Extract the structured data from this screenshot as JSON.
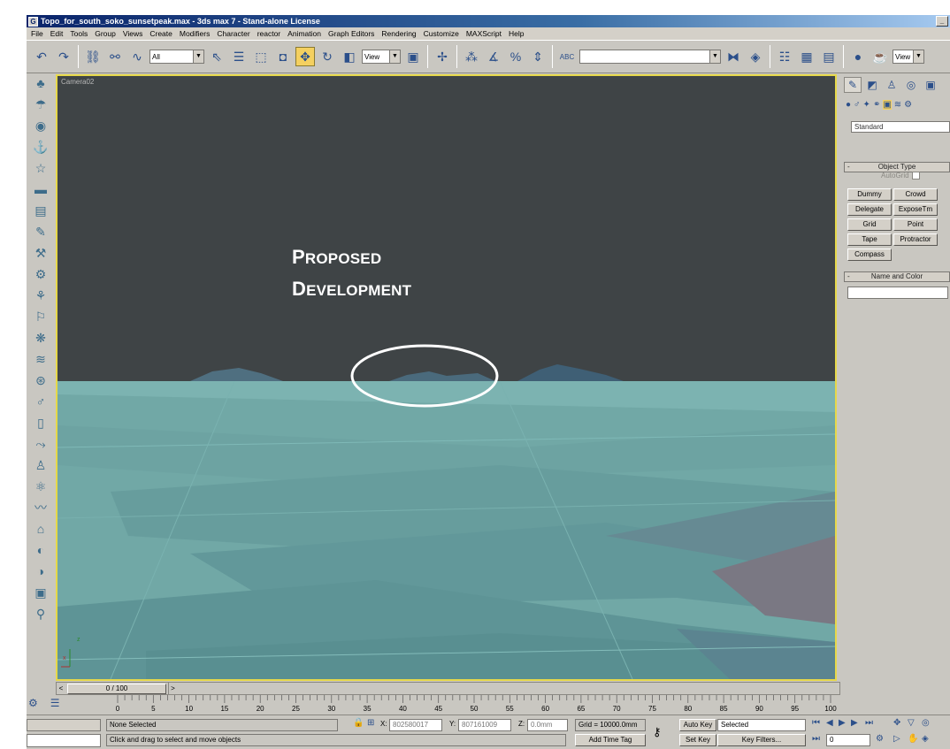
{
  "window": {
    "title": "Topo_for_south_soko_sunsetpeak.max - 3ds max 7 - Stand-alone License",
    "min_label": "_"
  },
  "menu": [
    "File",
    "Edit",
    "Tools",
    "Group",
    "Views",
    "Create",
    "Modifiers",
    "Character",
    "reactor",
    "Animation",
    "Graph Editors",
    "Rendering",
    "Customize",
    "MAXScript",
    "Help"
  ],
  "toolbar": {
    "selection_filter": "All",
    "reference_coord": "View",
    "named_selection": "",
    "viewport_select": "View",
    "snap_label": "ABC"
  },
  "viewport": {
    "label": "Camera02",
    "annotation_line1_cap": "P",
    "annotation_line1_rest": "ROPOSED",
    "annotation_line2_cap": "D",
    "annotation_line2_rest": "EVELOPMENT",
    "axis_z": "z",
    "axis_xy": "x"
  },
  "command_panel": {
    "category": "Standard",
    "object_type_title": "Object Type",
    "autogrid": "AutoGrid",
    "buttons": [
      "Dummy",
      "Crowd",
      "Delegate",
      "ExposeTm",
      "Grid",
      "Point",
      "Tape",
      "Protractor",
      "Compass"
    ],
    "name_color_title": "Name and Color"
  },
  "time_slider": {
    "frame": "0 / 100",
    "left": "<",
    "right": ">"
  },
  "track_labels": [
    "0",
    "5",
    "10",
    "15",
    "20",
    "25",
    "30",
    "35",
    "40",
    "45",
    "50",
    "55",
    "60",
    "65",
    "70",
    "75",
    "80",
    "85",
    "90",
    "95",
    "100"
  ],
  "status": {
    "selection": "None Selected",
    "prompt": "Click and drag to select and move objects",
    "x_label": "X:",
    "x_value": "802580017",
    "y_label": "Y:",
    "y_value": "807161009",
    "z_label": "Z:",
    "z_value": "0.0mm",
    "grid": "Grid = 10000.0mm",
    "add_time_tag": "Add Time Tag",
    "auto_key": "Auto Key",
    "set_key": "Set Key",
    "key_mode": "Selected",
    "key_filters": "Key Filters...",
    "frame_field": "0"
  }
}
